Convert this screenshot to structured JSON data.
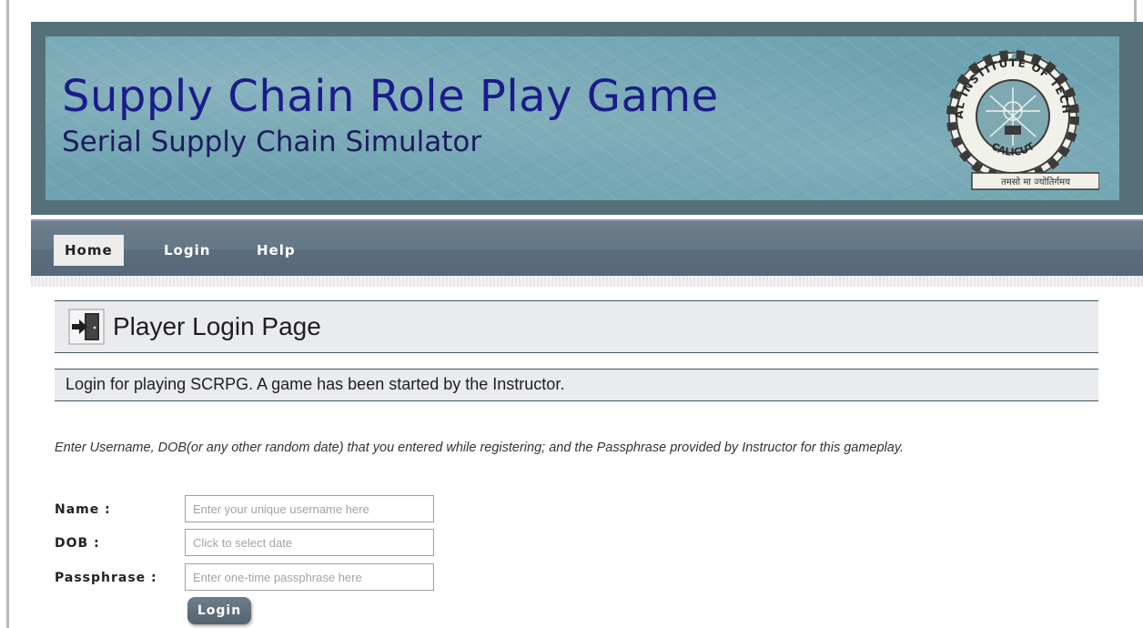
{
  "header": {
    "title": "Supply Chain Role Play Game",
    "subtitle": "Serial Supply Chain Simulator",
    "emblem": {
      "top_text": "NATIONAL INSTITUTE OF TECHNOLOGY",
      "bottom_text": "CALICUT",
      "motto": "तमसो मा ज्योतिर्गमय"
    }
  },
  "nav": {
    "items": [
      {
        "label": "Home",
        "active": true
      },
      {
        "label": "Login",
        "active": false
      },
      {
        "label": "Help",
        "active": false
      }
    ]
  },
  "main": {
    "page_title": "Player Login Page",
    "page_icon": "login-door-icon",
    "info": "Login for playing SCRPG. A game has been started by the Instructor.",
    "instructions": "Enter Username, DOB(or any other random date) that you entered while registering; and the Passphrase provided by Instructor for this gameplay."
  },
  "form": {
    "name_label": "Name :",
    "name_placeholder": "Enter your unique username here",
    "dob_label": "DOB :",
    "dob_placeholder": "Click to select date",
    "passphrase_label": "Passphrase :",
    "passphrase_placeholder": "Enter one-time passphrase here",
    "submit_label": "Login"
  },
  "colors": {
    "banner_frame": "#56707a",
    "banner_bg": "#6fa3b1",
    "title_color": "#1b1c8a",
    "nav_bg": "#647786",
    "box_bg": "#e9ebee"
  }
}
